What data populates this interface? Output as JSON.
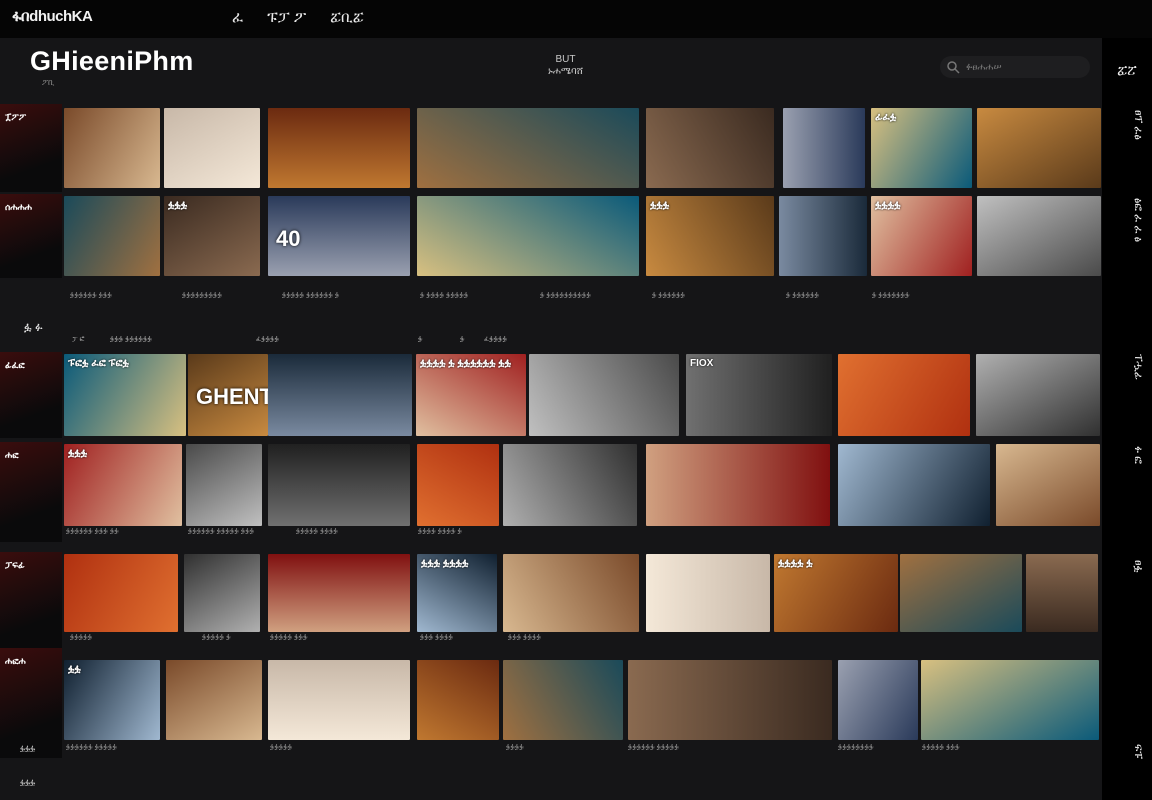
{
  "topbar": {
    "logo": "ፋበdhuchKA",
    "nav": [
      "ፈ",
      "ፑፓ ፖ",
      "ፚቢፚ"
    ]
  },
  "header": {
    "title": "GHieeniPhm",
    "subtitle": "ፖቢ",
    "center_line1": "BUT",
    "center_line2": "ኑሐሜባሸ",
    "search_placeholder": "ፉፀሐሐሠ"
  },
  "sidebar": {
    "items": [
      "ፚፘ",
      "ፀፕ ፈፅ",
      "ፅፎ ፈ ፈ ፅ",
      "ፐሗፊ",
      "ፉ ፎ",
      "ፀፏ",
      "ፍፑ"
    ]
  },
  "rails": [
    "ፗፖፖ",
    "ሰሐሐሐ",
    "ፊፈፎ",
    "ሐፎ",
    "ፓፍፊ",
    "ሐፎሐ"
  ],
  "section": {
    "icon_label": "ፏ ፉ",
    "labels": [
      "ፓ ፎ",
      "ፏፏፏ ፏፏፏፏፏፏ",
      "ፈፏፏፏፏ",
      "ፏ",
      "ፏ",
      "ፈፏፏፏፏ"
    ]
  },
  "tiles": [
    {
      "t": "",
      "big": ""
    },
    {
      "t": "",
      "big": ""
    },
    {
      "t": "",
      "big": ""
    },
    {
      "t": "",
      "big": ""
    },
    {
      "t": "",
      "big": ""
    },
    {
      "t": "",
      "big": ""
    },
    {
      "t": "ፊፈፏ",
      "big": ""
    },
    {
      "t": "",
      "big": ""
    },
    {
      "t": "",
      "big": ""
    },
    {
      "t": "ፏፏፏ",
      "big": ""
    },
    {
      "t": "",
      "big": "40"
    },
    {
      "t": "",
      "big": ""
    },
    {
      "t": "ፏፏፏ",
      "big": ""
    },
    {
      "t": "",
      "big": ""
    },
    {
      "t": "ፏፏፏፏ",
      "big": ""
    },
    {
      "t": "",
      "big": ""
    },
    {
      "t": "ፑፎፏ ፈፎ ፑፎፏ",
      "big": ""
    },
    {
      "t": "",
      "big": "GHENTER"
    },
    {
      "t": "",
      "big": ""
    },
    {
      "t": "ፏፏፏፏ ፏ ፏፏፏፏፏፏ ፏፏ",
      "big": ""
    },
    {
      "t": "",
      "big": ""
    },
    {
      "t": "FIOX",
      "big": ""
    },
    {
      "t": "",
      "big": ""
    },
    {
      "t": "",
      "big": ""
    },
    {
      "t": "ፏፏፏ",
      "big": ""
    },
    {
      "t": "",
      "big": ""
    },
    {
      "t": "",
      "big": ""
    },
    {
      "t": "",
      "big": ""
    },
    {
      "t": "",
      "big": ""
    },
    {
      "t": "",
      "big": ""
    },
    {
      "t": "",
      "big": ""
    },
    {
      "t": "",
      "big": ""
    },
    {
      "t": "",
      "big": ""
    },
    {
      "t": "",
      "big": ""
    },
    {
      "t": "",
      "big": ""
    },
    {
      "t": "ፏፏፏ ፏፏፏፏ",
      "big": ""
    },
    {
      "t": "",
      "big": ""
    },
    {
      "t": "",
      "big": ""
    },
    {
      "t": "ፏፏፏፏ ፏ",
      "big": ""
    },
    {
      "t": "",
      "big": ""
    },
    {
      "t": "",
      "big": ""
    },
    {
      "t": "ፏፏ",
      "big": ""
    },
    {
      "t": "",
      "big": ""
    },
    {
      "t": "",
      "big": ""
    },
    {
      "t": "",
      "big": ""
    }
  ],
  "captions": [
    "ፏፏፏፏፏፏ ፏፏፏ",
    "ፏፏፏፏፏፏፏፏፏ",
    "ፏፏፏፏፏ ፏፏፏፏፏፏ ፏ",
    "ፏ ፏፏፏፏ ፏፏፏፏፏ",
    "ፏ ፏፏፏፏፏፏፏፏፏፏ",
    "ፏ ፏፏፏፏፏፏ",
    "ፏ ፏፏፏፏፏፏ",
    "ፏ ፏፏፏፏፏፏፏ",
    "ፏፏፏፏፏፏ ፏፏፏ ፏፏ",
    "ፏፏፏፏፏፏ ፏፏፏፏፏ ፏፏፏ",
    "ፏፏፏፏፏ ፏፏፏፏ",
    "ፏፏፏፏ ፏፏፏፏ ፏ",
    "ፏፏፏፏፏ",
    "ፏፏፏፏፏ ፏ",
    "ፏፏፏፏፏ ፏፏፏ",
    "ፏፏፏ ፏፏፏፏ",
    "ፏፏፏ ፏፏፏፏ",
    "ፏፏፏፏፏፏ ፏፏፏፏፏ",
    "ፏፏፏፏፏ",
    "ፏፏፏፏ",
    "ፏፏፏፏፏፏ ፏፏፏፏፏ",
    "ፏፏፏፏፏፏፏፏ",
    "ፏፏፏፏፏ ፏፏፏ"
  ],
  "footer": [
    "ፏፏፏ",
    "ፏፏፏ"
  ],
  "colors": {
    "bg": "#151517",
    "topbar": "#050505",
    "sidebar": "#000000"
  }
}
